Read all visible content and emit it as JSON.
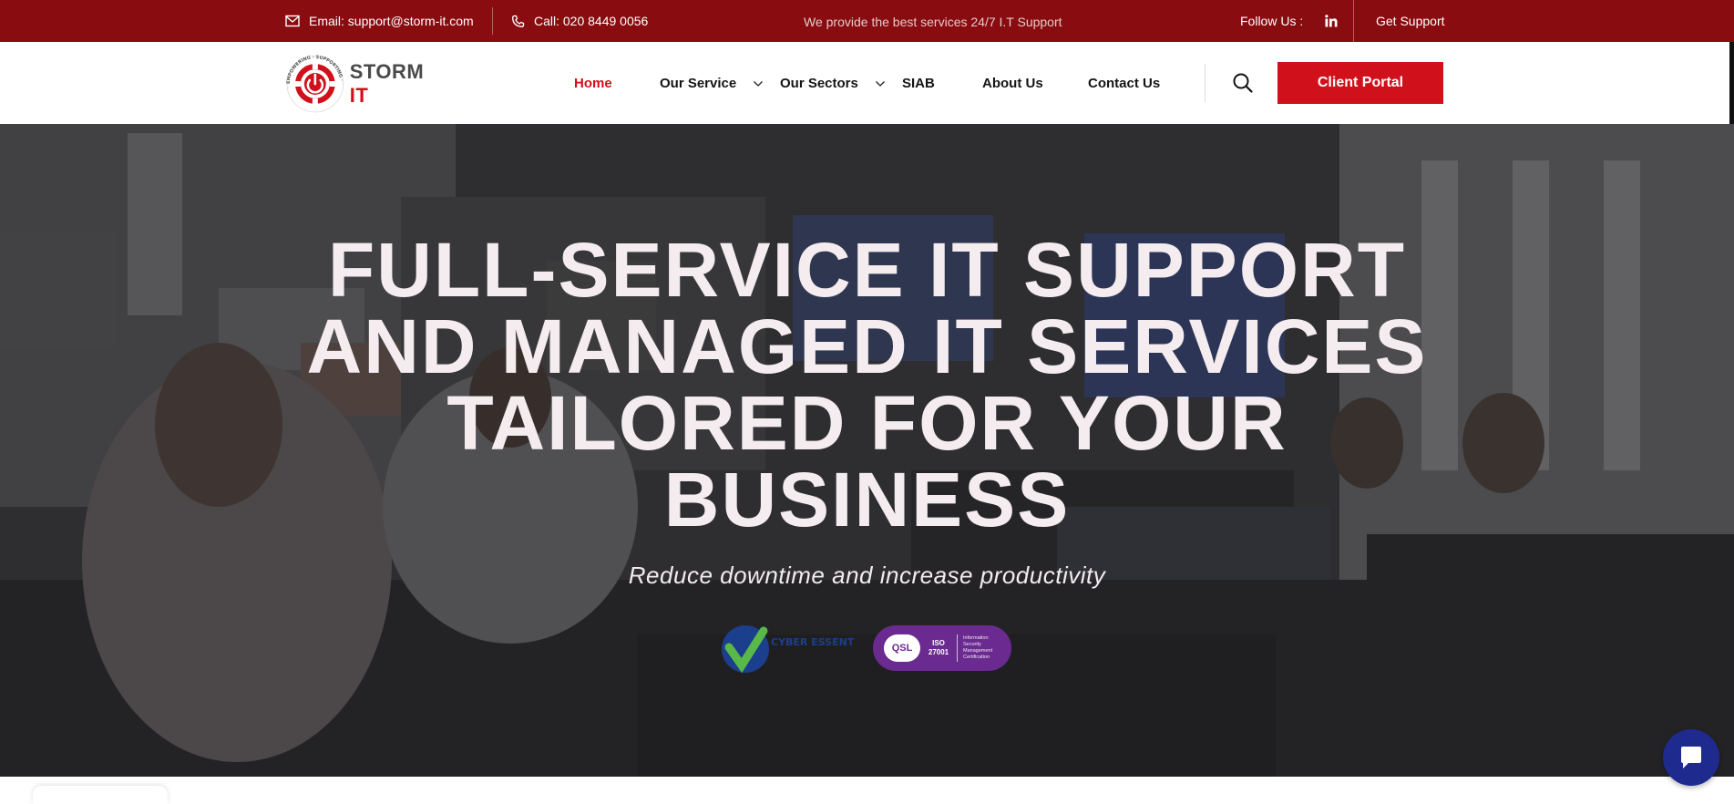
{
  "topbar": {
    "email": "Email: support@storm-it.com",
    "phone": "Call: 020 8449 0056",
    "tagline": "We provide the best services 24/7 I.T Support",
    "follow_label": "Follow Us :",
    "social_icon": "linkedin-icon",
    "get_support": "Get Support"
  },
  "header": {
    "logo": {
      "brand_main": "STORM",
      "brand_accent": "IT",
      "ring_text": "EMPOWERING · SUPPORTING · PROTECTING"
    },
    "nav": [
      {
        "label": "Home",
        "active": true,
        "dropdown": false
      },
      {
        "label": "Our Service",
        "active": false,
        "dropdown": true
      },
      {
        "label": "Our Sectors",
        "active": false,
        "dropdown": true
      },
      {
        "label": "SIAB",
        "active": false,
        "dropdown": false
      },
      {
        "label": "About Us",
        "active": false,
        "dropdown": false
      },
      {
        "label": "Contact Us",
        "active": false,
        "dropdown": false
      }
    ],
    "search_icon": "search-icon",
    "client_portal": "Client Portal"
  },
  "hero": {
    "headline_lines": [
      "FULL-SERVICE IT SUPPORT",
      "AND MANAGED IT SERVICES",
      "TAILORED FOR YOUR",
      "BUSINESS"
    ],
    "subline": "Reduce downtime and increase productivity",
    "badges": {
      "cyber_essentials": "CYBER ESSENTIALS",
      "qsl": "QSL",
      "iso": "ISO 27001",
      "iso_caption": "Information Security Management Certification"
    }
  },
  "chat": {
    "icon": "chat-bubble-icon"
  },
  "colors": {
    "topbar": "#890c10",
    "accent": "#d0101a",
    "chat": "#1f2a8f",
    "iso_badge": "#6a2a8f"
  }
}
